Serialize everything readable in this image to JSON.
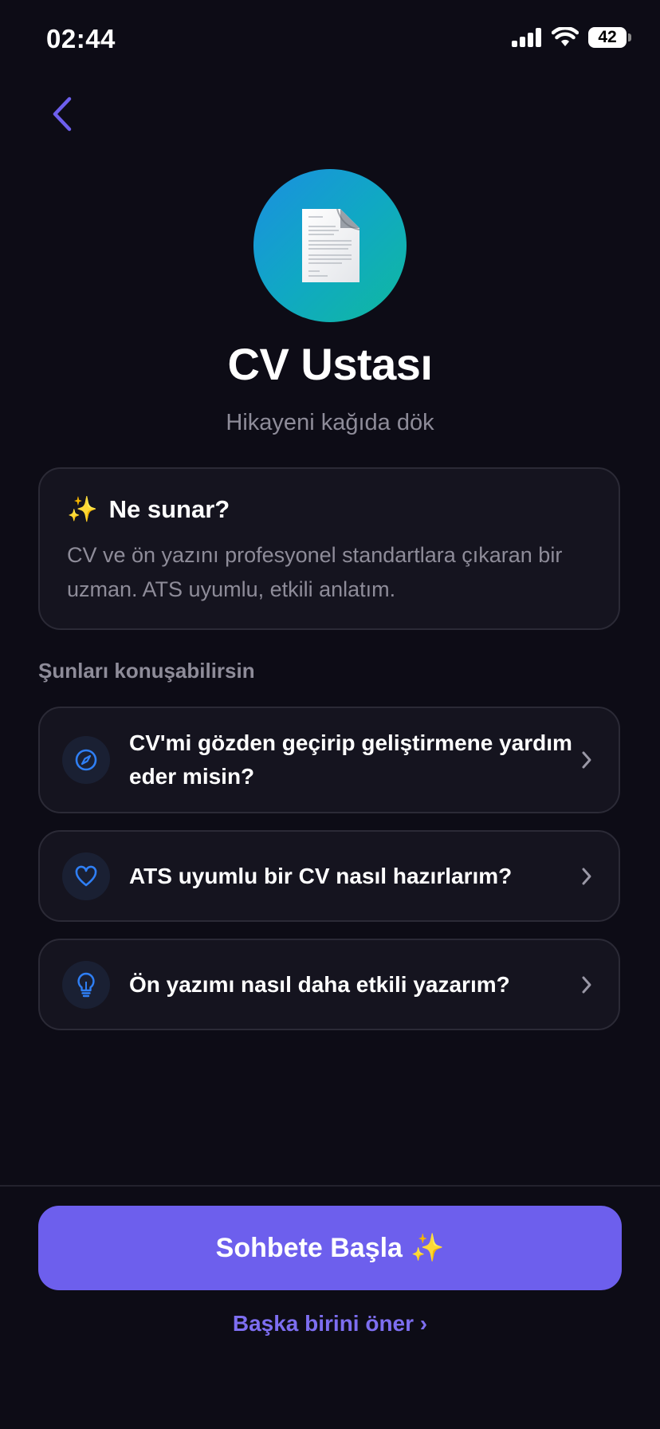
{
  "status_bar": {
    "time": "02:44",
    "battery": "42",
    "icons": [
      "cellular-signal-icon",
      "wifi-icon",
      "battery-icon"
    ]
  },
  "nav": {
    "back_icon": "chevron-left-icon"
  },
  "profile": {
    "avatar_icon": "document-page-icon",
    "title": "CV Ustası",
    "subtitle": "Hikayeni kağıda dök"
  },
  "info_card": {
    "emoji": "✨",
    "heading": "Ne sunar?",
    "body": "CV ve ön yazını profesyonel standartlara çıkaran bir uzman. ATS uyumlu, etkili anlatım."
  },
  "section_label": "Şunları konuşabilirsin",
  "suggestions": [
    {
      "icon": "compass-icon",
      "label": "CV'mi gözden geçirip geliştirmene yardım eder misin?"
    },
    {
      "icon": "heart-icon",
      "label": "ATS uyumlu bir CV nasıl hazırlarım?"
    },
    {
      "icon": "lightbulb-icon",
      "label": "Ön yazımı nasıl daha etkili yazarım?"
    }
  ],
  "footer": {
    "cta_label": "Sohbete Başla",
    "cta_emoji": "✨",
    "link_label": "Başka birini öner ›"
  },
  "colors": {
    "background": "#0d0c16",
    "card": "#15141f",
    "accent": "#6d5fed",
    "link": "#7d6ef0",
    "icon_blue": "#2f7ff5",
    "muted_text": "#8e8c99"
  }
}
